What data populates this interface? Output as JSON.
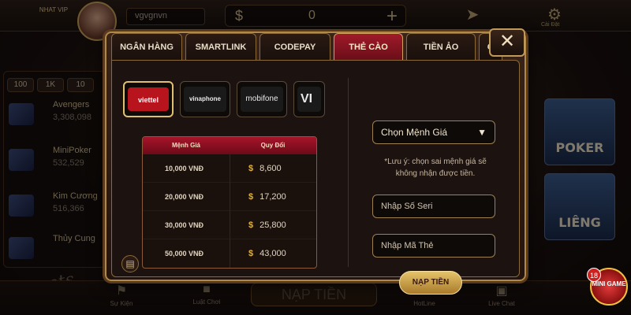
{
  "top": {
    "logo_text": "NHAT VIP",
    "username": "vgvgnvn",
    "balance_currency": "$",
    "balance": "0",
    "add_label": "+",
    "settings_label": "Cài Đặt"
  },
  "jackpot_panel": {
    "chips": [
      "100",
      "1K",
      "10"
    ],
    "items": [
      {
        "name": "Avengers",
        "value": "3,308,098"
      },
      {
        "name": "MiniPoker",
        "value": "532,529"
      },
      {
        "name": "Kim Cương",
        "value": "516,366"
      },
      {
        "name": "Thủy Cung",
        "value": "—"
      }
    ],
    "title": "Jackpots"
  },
  "right_games": [
    {
      "label": "POKER"
    },
    {
      "label": "LIÊNG"
    }
  ],
  "mini_game": {
    "badge": "18",
    "label": "MINI GAME"
  },
  "bottom_bar": {
    "items": [
      {
        "icon": "flag-icon",
        "label": "Sự Kiện"
      },
      {
        "icon": "chat-icon",
        "label": "Luật Chơi"
      },
      {
        "icon": "phone-icon",
        "label": "HotLine"
      },
      {
        "icon": "livechat-icon",
        "label": "Live Chat"
      }
    ],
    "center_text": "NẠP TIỀN"
  },
  "modal": {
    "tabs": [
      "NGÂN HÀNG",
      "SMARTLINK",
      "CODEPAY",
      "THẺ CÀO",
      "TIỀN ẢO",
      "G"
    ],
    "active_tab_index": 3,
    "close_label": "✕",
    "carriers": [
      {
        "name": "viettel",
        "label": "viettel"
      },
      {
        "name": "vinaphone",
        "label": "vinaphone"
      },
      {
        "name": "mobifone",
        "label": "mobifone"
      },
      {
        "name": "vietnamobile",
        "label": "VI"
      }
    ],
    "selected_carrier": "viettel",
    "table": {
      "headers": [
        "Mệnh Giá",
        "Quy Đổi"
      ],
      "rows": [
        {
          "denomination": "10,000 VNĐ",
          "currency": "$",
          "converted": "8,600"
        },
        {
          "denomination": "20,000 VNĐ",
          "currency": "$",
          "converted": "17,200"
        },
        {
          "denomination": "30,000 VNĐ",
          "currency": "$",
          "converted": "25,800"
        },
        {
          "denomination": "50,000 VNĐ",
          "currency": "$",
          "converted": "43,000"
        }
      ]
    },
    "select_denomination": "Chọn Mệnh Giá",
    "note": "*Lưu ý: chọn sai mệnh giá sẽ không nhận được tiền.",
    "serial_placeholder": "Nhập Số Seri",
    "pin_placeholder": "Nhập Mã Thẻ",
    "submit_label": "NẠP TIỀN"
  }
}
